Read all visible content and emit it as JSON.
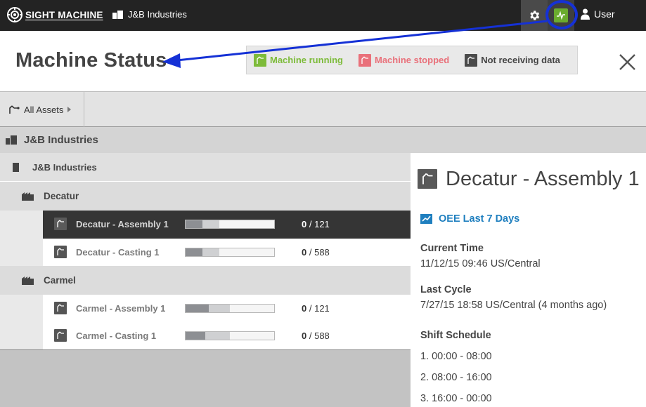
{
  "topbar": {
    "logo_text": "SIGHT MACHINE",
    "company": "J&B Industries",
    "user": "User",
    "icons": [
      "gear-icon",
      "machine-status-icon",
      "user-icon"
    ],
    "status_color": "#6aab2e"
  },
  "header": {
    "title": "Machine Status",
    "legend": [
      {
        "label": "Machine running",
        "color": "#7dbb3a"
      },
      {
        "label": "Machine stopped",
        "color": "#e9707a"
      },
      {
        "label": "Not receiving data",
        "color": "#4a4a4a"
      }
    ]
  },
  "breadcrumb": {
    "label": "All Assets"
  },
  "tree": {
    "enterprise": "J&B Industries",
    "site": "J&B Industries",
    "areas": [
      {
        "name": "Decatur",
        "machines": [
          {
            "name": "Decatur - Assembly 1",
            "count": "0",
            "total": "/ 121",
            "dark_fraction": 0.19,
            "light_fraction": 0.19,
            "selected": true
          },
          {
            "name": "Decatur - Casting 1",
            "count": "0",
            "total": "/ 588",
            "dark_fraction": 0.19,
            "light_fraction": 0.19,
            "selected": false
          }
        ]
      },
      {
        "name": "Carmel",
        "machines": [
          {
            "name": "Carmel - Assembly 1",
            "count": "0",
            "total": "/ 121",
            "dark_fraction": 0.26,
            "light_fraction": 0.24,
            "selected": false
          },
          {
            "name": "Carmel - Casting 1",
            "count": "0",
            "total": "/ 588",
            "dark_fraction": 0.22,
            "light_fraction": 0.28,
            "selected": false
          }
        ]
      }
    ]
  },
  "detail": {
    "title": "Decatur - Assembly 1",
    "oee_link": "OEE Last 7 Days",
    "current_time_label": "Current Time",
    "current_time_value": "11/12/15 09:46 US/Central",
    "last_cycle_label": "Last Cycle",
    "last_cycle_value": "7/27/15 18:58 US/Central (4 months ago)",
    "shift_label": "Shift Schedule",
    "shifts": [
      "1.  00:00 - 08:00",
      "2.  08:00 - 16:00",
      "3.  16:00 - 00:00"
    ]
  },
  "annotation": {
    "color": "#1531d6"
  }
}
